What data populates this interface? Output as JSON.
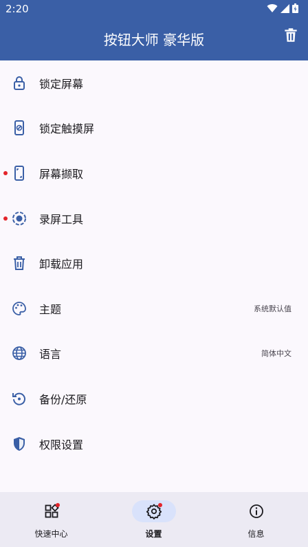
{
  "status_bar": {
    "time": "2:20",
    "icons": [
      "wifi-icon",
      "signal-icon",
      "battery-icon"
    ]
  },
  "app_bar": {
    "title": "按钮大师 豪华版",
    "action_icon": "trash-icon"
  },
  "menu": {
    "items": [
      {
        "label": "锁定屏幕",
        "icon": "lock-icon",
        "value": "",
        "badge": false
      },
      {
        "label": "锁定触摸屏",
        "icon": "touch-lock-icon",
        "value": "",
        "badge": false
      },
      {
        "label": "屏幕撷取",
        "icon": "screenshot-icon",
        "value": "",
        "badge": true
      },
      {
        "label": "录屏工具",
        "icon": "record-icon",
        "value": "",
        "badge": true
      },
      {
        "label": "卸载应用",
        "icon": "uninstall-icon",
        "value": "",
        "badge": false
      },
      {
        "label": "主题",
        "icon": "palette-icon",
        "value": "系统默认值",
        "badge": false
      },
      {
        "label": "语言",
        "icon": "globe-icon",
        "value": "简体中文",
        "badge": false
      },
      {
        "label": "备份/还原",
        "icon": "restore-icon",
        "value": "",
        "badge": false
      },
      {
        "label": "权限设置",
        "icon": "shield-icon",
        "value": "",
        "badge": false
      }
    ]
  },
  "bottom_nav": {
    "items": [
      {
        "label": "快速中心",
        "icon": "widgets-icon",
        "active": false,
        "badge": true
      },
      {
        "label": "设置",
        "icon": "settings-icon",
        "active": true,
        "badge": true
      },
      {
        "label": "信息",
        "icon": "info-icon",
        "active": false,
        "badge": false
      }
    ]
  },
  "colors": {
    "app_bar": "#3a5fa6",
    "icon": "#3a5fa6",
    "badge": "#e3242b",
    "background": "#fbf8fd",
    "nav_background": "#eceaf3",
    "nav_active_pill": "#d9e2fb"
  }
}
